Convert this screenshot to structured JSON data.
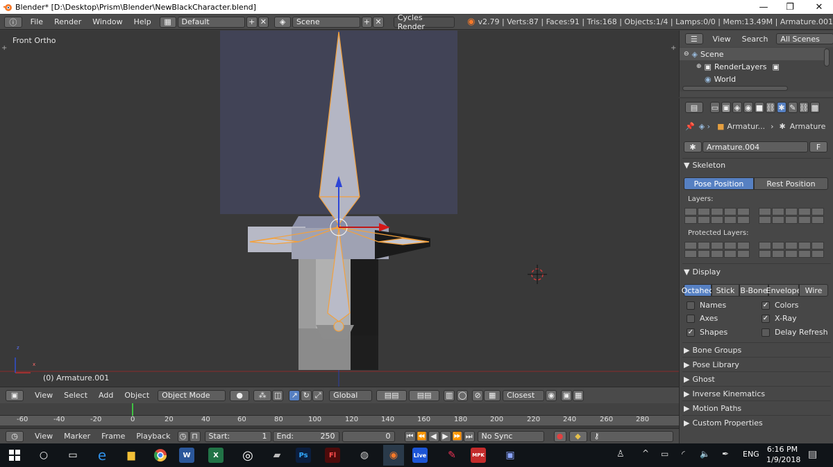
{
  "window": {
    "title": "Blender* [D:\\Desktop\\Prism\\Blender\\NewBlackCharacter.blend]",
    "min": "—",
    "max": "❐",
    "close": "✕"
  },
  "info_header": {
    "menus": [
      "File",
      "Render",
      "Window",
      "Help"
    ],
    "screen_layout": "Default",
    "scene": "Scene",
    "render_engine": "Cycles Render",
    "stats": "v2.79 | Verts:87 | Faces:91 | Tris:168 | Objects:1/4 | Lamps:0/0 | Mem:13.49M | Armature.001"
  },
  "viewport": {
    "view_label": "Front Ortho",
    "object_label": "(0) Armature.001",
    "axis_x": "x",
    "axis_z": "z"
  },
  "view3d_header": {
    "menus": [
      "View",
      "Select",
      "Add",
      "Object"
    ],
    "mode": "Object Mode",
    "orientation": "Global",
    "snap_target": "Closest"
  },
  "timeline": {
    "ticks": [
      "-60",
      "-40",
      "-20",
      "0",
      "20",
      "40",
      "60",
      "80",
      "100",
      "120",
      "140",
      "160",
      "180",
      "200",
      "220",
      "240",
      "260",
      "280"
    ],
    "menus": [
      "View",
      "Marker",
      "Frame",
      "Playback"
    ],
    "start_label": "Start:",
    "start_value": "1",
    "end_label": "End:",
    "end_value": "250",
    "current_frame": "0",
    "sync": "No Sync"
  },
  "outliner": {
    "menus": [
      "View",
      "Search"
    ],
    "filter": "All Scenes",
    "items": [
      "Scene",
      "RenderLayers",
      "World"
    ]
  },
  "properties": {
    "breadcrumb_object": "Armatur...",
    "breadcrumb_data": "Armature",
    "datablock_name": "Armature.004",
    "datablock_fake": "F",
    "skeleton": {
      "title": "Skeleton",
      "pose_position": "Pose Position",
      "rest_position": "Rest Position",
      "layers_label": "Layers:",
      "protected_label": "Protected Layers:"
    },
    "display": {
      "title": "Display",
      "draw_types": [
        "Octahed",
        "Stick",
        "B-Bone",
        "Envelope",
        "Wire"
      ],
      "active_draw_type": "Octahed",
      "checks_left": [
        {
          "label": "Names",
          "checked": false
        },
        {
          "label": "Axes",
          "checked": false
        },
        {
          "label": "Shapes",
          "checked": true
        }
      ],
      "checks_right": [
        {
          "label": "Colors",
          "checked": true
        },
        {
          "label": "X-Ray",
          "checked": true
        },
        {
          "label": "Delay Refresh",
          "checked": false
        }
      ]
    },
    "collapsed_panels": [
      "Bone Groups",
      "Pose Library",
      "Ghost",
      "Inverse Kinematics",
      "Motion Paths",
      "Custom Properties"
    ]
  },
  "taskbar": {
    "language": "ENG",
    "time": "6:16 PM",
    "date": "1/9/2018",
    "app_labels": {
      "photoshop": "Ps",
      "flash": "Fl",
      "live": "Live",
      "mpk": "MPK"
    }
  }
}
